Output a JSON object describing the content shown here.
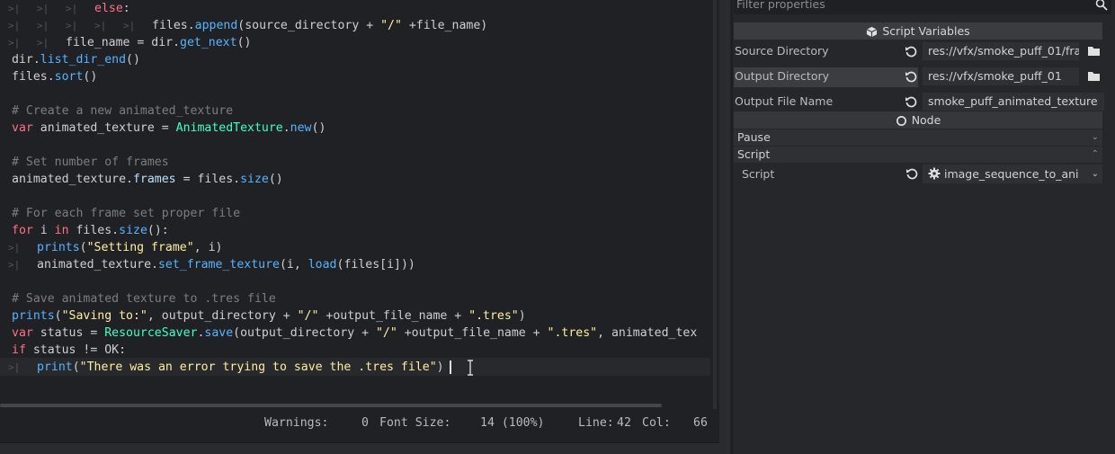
{
  "code_lines": [
    {
      "tabs": 3,
      "parts": [
        {
          "t": "else",
          "c": "kw"
        },
        {
          "t": ":",
          "c": ""
        }
      ]
    },
    {
      "tabs": 5,
      "parts": [
        {
          "t": "files",
          "c": ""
        },
        {
          "t": ".",
          "c": ""
        },
        {
          "t": "append",
          "c": "fn"
        },
        {
          "t": "(source_directory + ",
          "c": ""
        },
        {
          "t": "\"/\"",
          "c": "str"
        },
        {
          "t": " +file_name)",
          "c": ""
        }
      ]
    },
    {
      "tabs": 2,
      "parts": [
        {
          "t": "file_name = dir.",
          "c": ""
        },
        {
          "t": "get_next",
          "c": "fn"
        },
        {
          "t": "()",
          "c": ""
        }
      ]
    },
    {
      "tabs": 0,
      "parts": [
        {
          "t": "dir.",
          "c": ""
        },
        {
          "t": "list_dir_end",
          "c": "fn"
        },
        {
          "t": "()",
          "c": ""
        }
      ]
    },
    {
      "tabs": 0,
      "parts": [
        {
          "t": "files.",
          "c": ""
        },
        {
          "t": "sort",
          "c": "fn"
        },
        {
          "t": "()",
          "c": ""
        }
      ]
    },
    {
      "tabs": 0,
      "parts": []
    },
    {
      "tabs": 0,
      "parts": [
        {
          "t": "# Create a new animated_texture",
          "c": "cm"
        }
      ]
    },
    {
      "tabs": 0,
      "parts": [
        {
          "t": "var",
          "c": "kw"
        },
        {
          "t": " animated_texture = ",
          "c": ""
        },
        {
          "t": "AnimatedTexture",
          "c": "cls"
        },
        {
          "t": ".",
          "c": ""
        },
        {
          "t": "new",
          "c": "fn"
        },
        {
          "t": "()",
          "c": ""
        }
      ]
    },
    {
      "tabs": 0,
      "parts": []
    },
    {
      "tabs": 0,
      "parts": [
        {
          "t": "# Set number of frames",
          "c": "cm"
        }
      ]
    },
    {
      "tabs": 0,
      "parts": [
        {
          "t": "animated_texture.",
          "c": ""
        },
        {
          "t": "frames",
          "c": "mb"
        },
        {
          "t": " = files.",
          "c": ""
        },
        {
          "t": "size",
          "c": "fn"
        },
        {
          "t": "()",
          "c": ""
        }
      ]
    },
    {
      "tabs": 0,
      "parts": []
    },
    {
      "tabs": 0,
      "parts": [
        {
          "t": "# For each frame set proper file",
          "c": "cm"
        }
      ]
    },
    {
      "tabs": 0,
      "parts": [
        {
          "t": "for",
          "c": "kw"
        },
        {
          "t": " i ",
          "c": ""
        },
        {
          "t": "in",
          "c": "kw"
        },
        {
          "t": " files.",
          "c": ""
        },
        {
          "t": "size",
          "c": "fn"
        },
        {
          "t": "():",
          "c": ""
        }
      ]
    },
    {
      "tabs": 1,
      "parts": [
        {
          "t": "prints",
          "c": "fn"
        },
        {
          "t": "(",
          "c": ""
        },
        {
          "t": "\"Setting frame\"",
          "c": "str"
        },
        {
          "t": ", i)",
          "c": ""
        }
      ]
    },
    {
      "tabs": 1,
      "parts": [
        {
          "t": "animated_texture.",
          "c": ""
        },
        {
          "t": "set_frame_texture",
          "c": "fn"
        },
        {
          "t": "(i, ",
          "c": ""
        },
        {
          "t": "load",
          "c": "fn"
        },
        {
          "t": "(files[i]))",
          "c": ""
        }
      ]
    },
    {
      "tabs": 0,
      "parts": []
    },
    {
      "tabs": 0,
      "parts": [
        {
          "t": "# Save animated texture to .tres file",
          "c": "cm"
        }
      ]
    },
    {
      "tabs": 0,
      "parts": [
        {
          "t": "prints",
          "c": "fn"
        },
        {
          "t": "(",
          "c": ""
        },
        {
          "t": "\"Saving to:\"",
          "c": "str"
        },
        {
          "t": ", output_directory + ",
          "c": ""
        },
        {
          "t": "\"/\"",
          "c": "str"
        },
        {
          "t": " +output_file_name + ",
          "c": ""
        },
        {
          "t": "\".tres\"",
          "c": "str"
        },
        {
          "t": ")",
          "c": ""
        }
      ]
    },
    {
      "tabs": 0,
      "parts": [
        {
          "t": "var",
          "c": "kw"
        },
        {
          "t": " status = ",
          "c": ""
        },
        {
          "t": "ResourceSaver",
          "c": "cls"
        },
        {
          "t": ".",
          "c": ""
        },
        {
          "t": "save",
          "c": "fn"
        },
        {
          "t": "(output_directory + ",
          "c": ""
        },
        {
          "t": "\"/\"",
          "c": "str"
        },
        {
          "t": " +output_file_name + ",
          "c": ""
        },
        {
          "t": "\".tres\"",
          "c": "str"
        },
        {
          "t": ", animated_tex",
          "c": ""
        }
      ]
    },
    {
      "tabs": 0,
      "parts": [
        {
          "t": "if",
          "c": "kw"
        },
        {
          "t": " status != OK:",
          "c": ""
        }
      ]
    },
    {
      "tabs": 1,
      "parts": [
        {
          "t": "print",
          "c": "fn"
        },
        {
          "t": "(",
          "c": ""
        },
        {
          "t": "\"There was an error trying to save the .tres file\"",
          "c": "str"
        },
        {
          "t": ")",
          "c": ""
        }
      ]
    }
  ],
  "status": {
    "warnings_label": "Warnings:",
    "warnings_value": "0",
    "font_size_label": "Font Size:",
    "font_size_value": "14 (100%)",
    "line_label": "Line:",
    "line_value": "42",
    "col_label": "Col:",
    "col_value": "66"
  },
  "inspector": {
    "filter_placeholder": "Filter properties",
    "section_script_variables": "Script Variables",
    "props": [
      {
        "label": "Source Directory",
        "value": "res://vfx/smoke_puff_01/fra",
        "folder": true
      },
      {
        "label": "Output Directory",
        "value": "res://vfx/smoke_puff_01",
        "folder": true
      },
      {
        "label": "Output File Name",
        "value": "smoke_puff_animated_texture",
        "folder": false
      }
    ],
    "section_node": "Node",
    "cat_pause": "Pause",
    "cat_script": "Script",
    "script_label": "Script",
    "script_value": "image_sequence_to_ani"
  },
  "colors": {
    "keyword": "#ff7085",
    "function": "#57b3ff",
    "string": "#ffeda1",
    "class": "#42ffc2",
    "comment": "#7a7d84"
  }
}
